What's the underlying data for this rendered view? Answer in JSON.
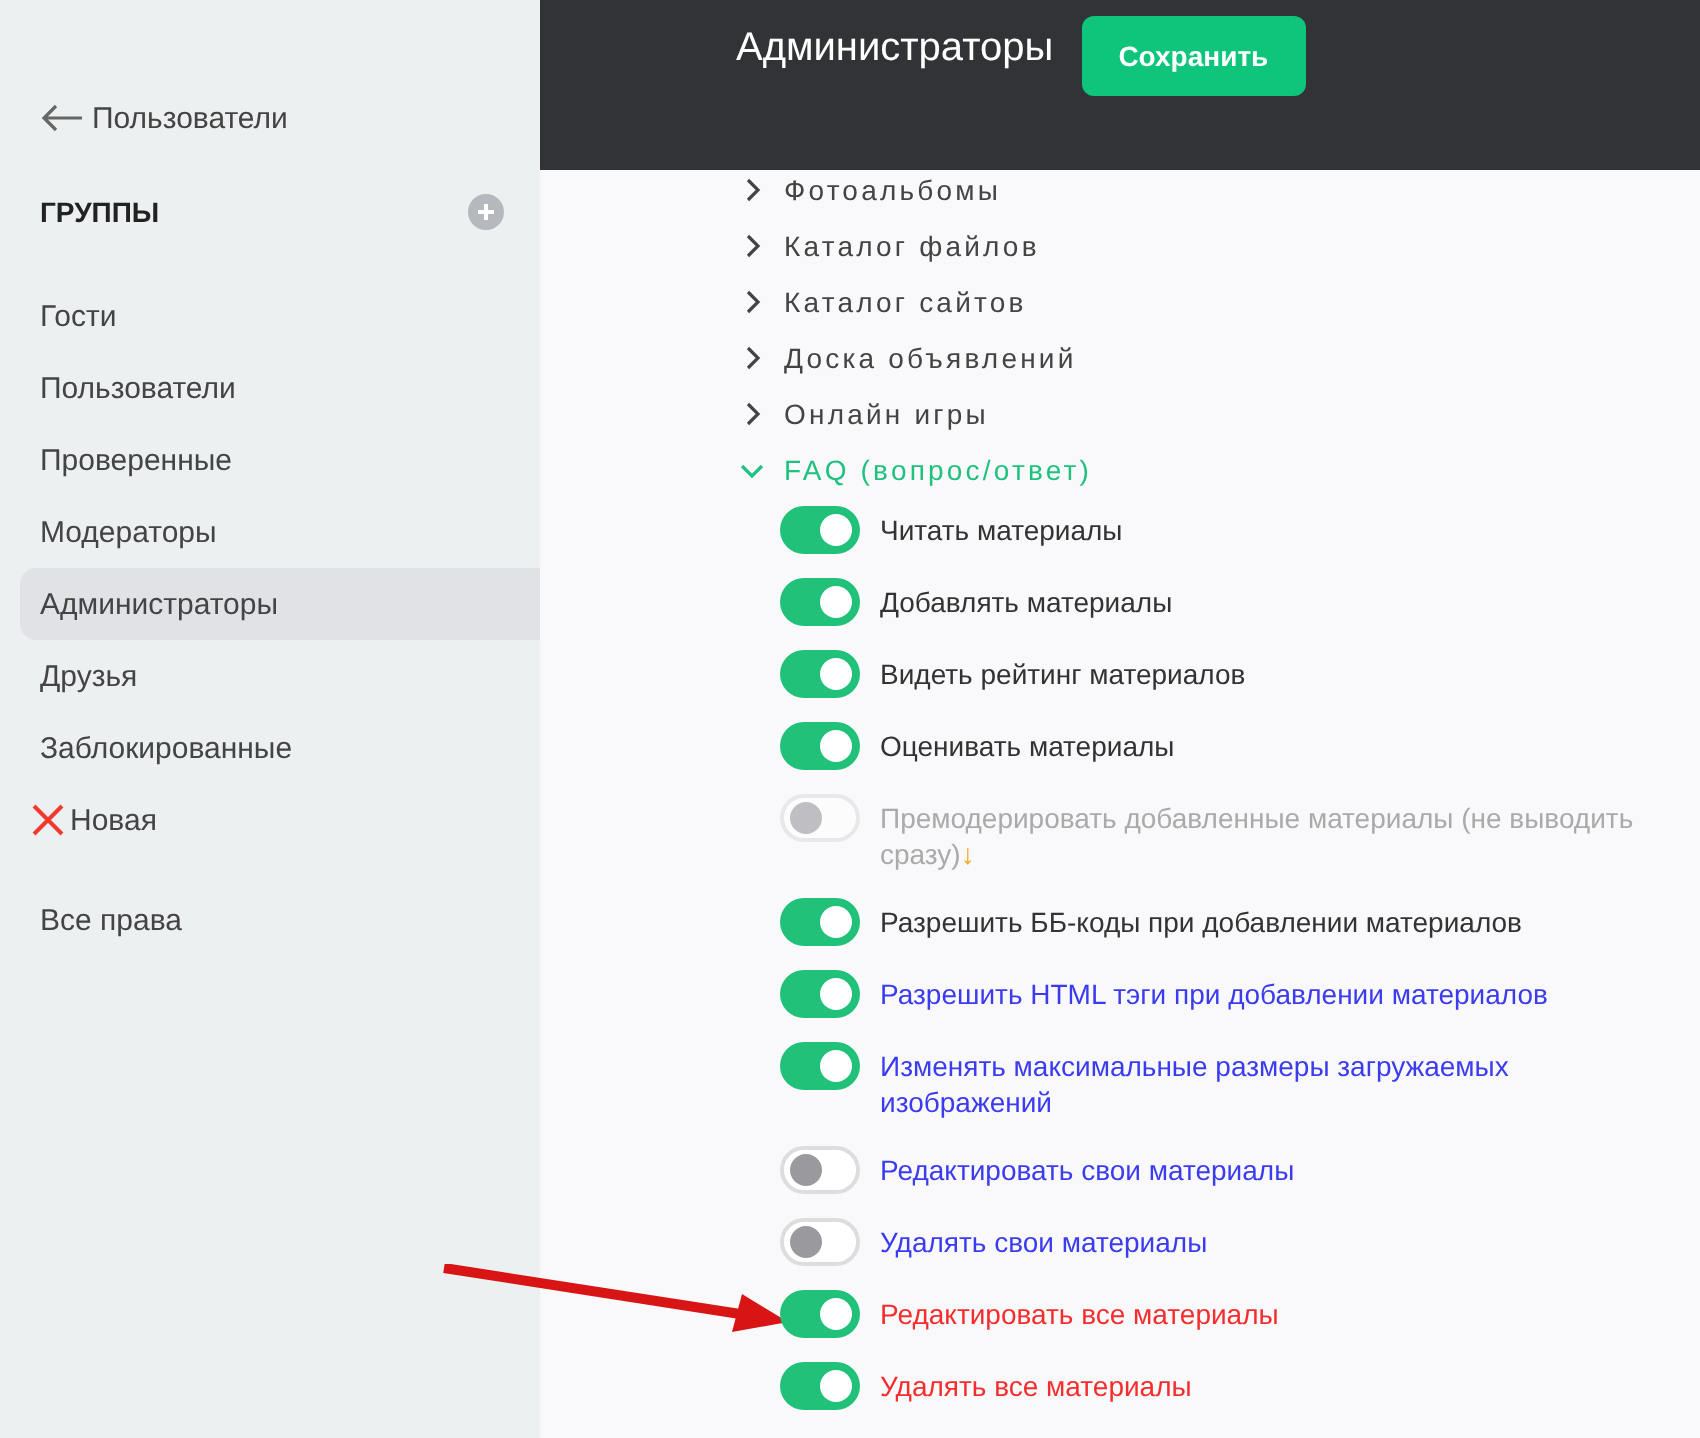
{
  "sidebar": {
    "back_link": "Пользователи",
    "heading": "ГРУППЫ",
    "items": [
      {
        "label": "Гости",
        "kind": "group",
        "selected": false
      },
      {
        "label": "Пользователи",
        "kind": "group",
        "selected": false
      },
      {
        "label": "Проверенные",
        "kind": "group",
        "selected": false
      },
      {
        "label": "Модераторы",
        "kind": "group",
        "selected": false
      },
      {
        "label": "Администраторы",
        "kind": "group",
        "selected": true
      },
      {
        "label": "Друзья",
        "kind": "group",
        "selected": false
      },
      {
        "label": "Заблокированные",
        "kind": "group",
        "selected": false
      },
      {
        "label": "Новая",
        "kind": "new",
        "selected": false
      }
    ],
    "all_rights": "Все права"
  },
  "header": {
    "title": "Администраторы",
    "save_button": "Сохранить"
  },
  "sections": [
    {
      "label": "Фотоальбомы",
      "expanded": false
    },
    {
      "label": "Каталог файлов",
      "expanded": false
    },
    {
      "label": "Каталог сайтов",
      "expanded": false
    },
    {
      "label": "Доска объявлений",
      "expanded": false
    },
    {
      "label": "Онлайн игры",
      "expanded": false
    },
    {
      "label": "FAQ (вопрос/ответ)",
      "expanded": true,
      "children": [
        {
          "label": "Читать материалы",
          "on": true,
          "disabled": false,
          "color": "#333333",
          "pointed": false
        },
        {
          "label": "Добавлять материалы",
          "on": true,
          "disabled": false,
          "color": "#333333",
          "pointed": false
        },
        {
          "label": "Видеть рейтинг материалов",
          "on": true,
          "disabled": false,
          "color": "#333333",
          "pointed": false
        },
        {
          "label": "Оценивать материалы",
          "on": true,
          "disabled": false,
          "color": "#333333",
          "pointed": false
        },
        {
          "label": "Премодерировать добавленные материалы (не выводить сразу)",
          "marker": "↓",
          "on": false,
          "disabled": true,
          "color": "#aaaaaa",
          "pointed": false
        },
        {
          "label": "Разрешить ББ-коды при добавлении материалов",
          "on": true,
          "disabled": false,
          "color": "#333333",
          "pointed": false
        },
        {
          "label": "Разрешить HTML тэги при добавлении материалов",
          "on": true,
          "disabled": false,
          "color": "#3b3bef",
          "pointed": false
        },
        {
          "label": "Изменять максимальные размеры загружаемых изображений",
          "on": true,
          "disabled": false,
          "color": "#3b3bef",
          "pointed": false
        },
        {
          "label": "Редактировать свои материалы",
          "on": false,
          "disabled": false,
          "color": "#3b3bef",
          "pointed": false
        },
        {
          "label": "Удалять свои материалы",
          "on": false,
          "disabled": false,
          "color": "#3b3bef",
          "pointed": false
        },
        {
          "label": "Редактировать все материалы",
          "on": true,
          "disabled": false,
          "color": "#f52d2d",
          "pointed": true
        },
        {
          "label": "Удалять все материалы",
          "on": true,
          "disabled": false,
          "color": "#f52d2d",
          "pointed": false
        }
      ]
    }
  ]
}
